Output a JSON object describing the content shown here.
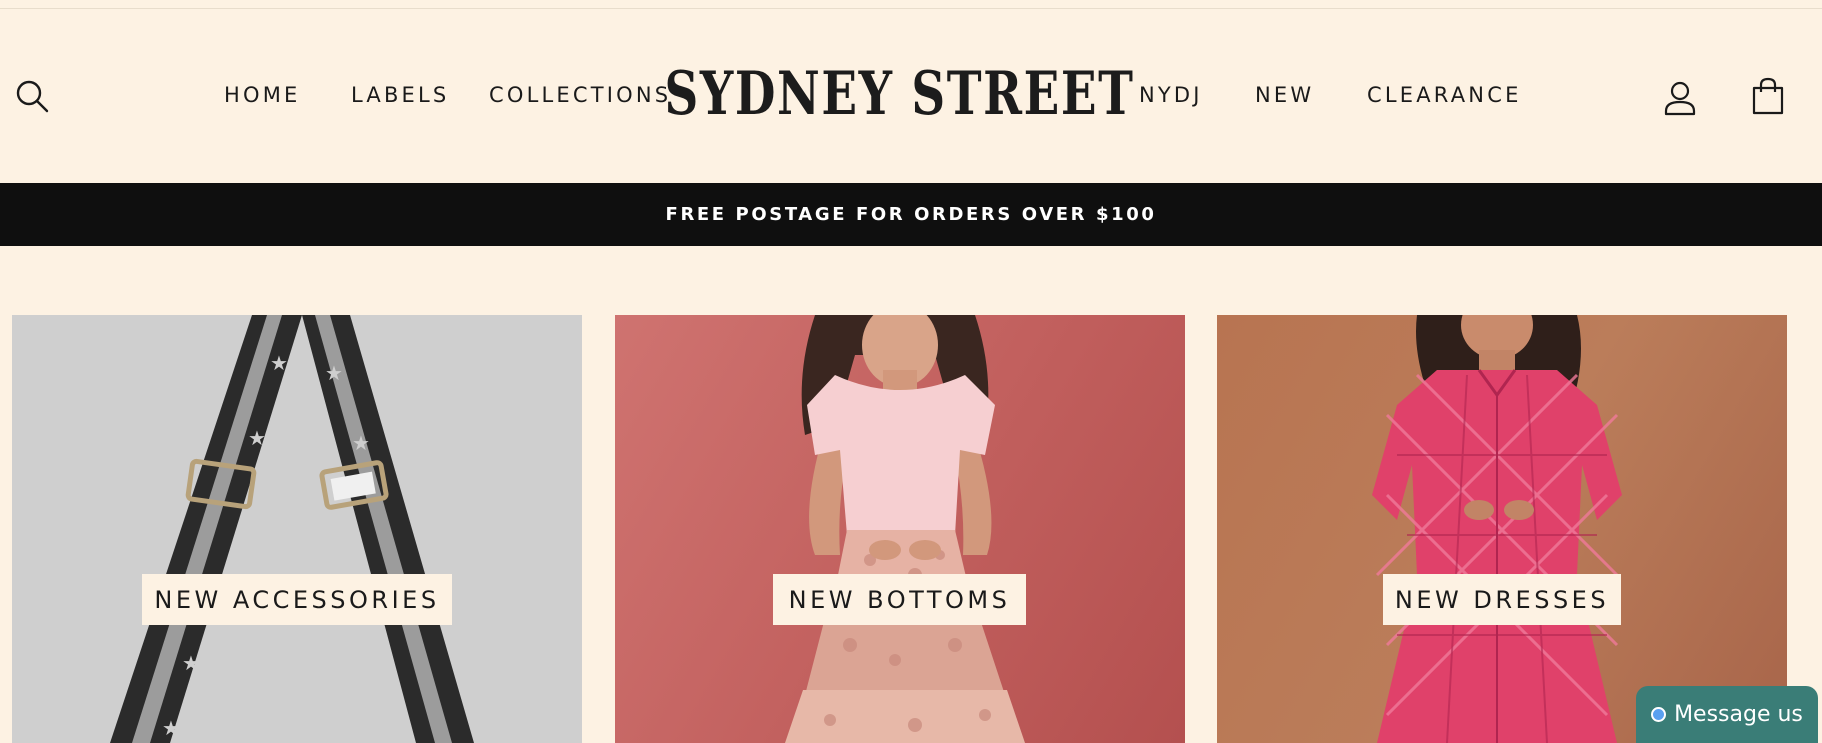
{
  "header": {
    "logo_text": "SYDNEY STREET",
    "nav_left": [
      "HOME",
      "LABELS",
      "COLLECTIONS"
    ],
    "nav_right": [
      "NYDJ",
      "NEW",
      "CLEARANCE"
    ],
    "icons": {
      "search": "search-icon",
      "account": "account-icon",
      "cart": "cart-icon"
    }
  },
  "announcement": {
    "text": "FREE POSTAGE FOR ORDERS OVER $100"
  },
  "tiles": [
    {
      "label": "NEW ACCESSORIES"
    },
    {
      "label": "NEW BOTTOMS"
    },
    {
      "label": "NEW DRESSES"
    }
  ],
  "chat": {
    "label": "Message us"
  },
  "colors": {
    "background": "#fdf2e3",
    "announcement_bg": "#0f0f0f",
    "chat_bg": "#3a7d77"
  }
}
